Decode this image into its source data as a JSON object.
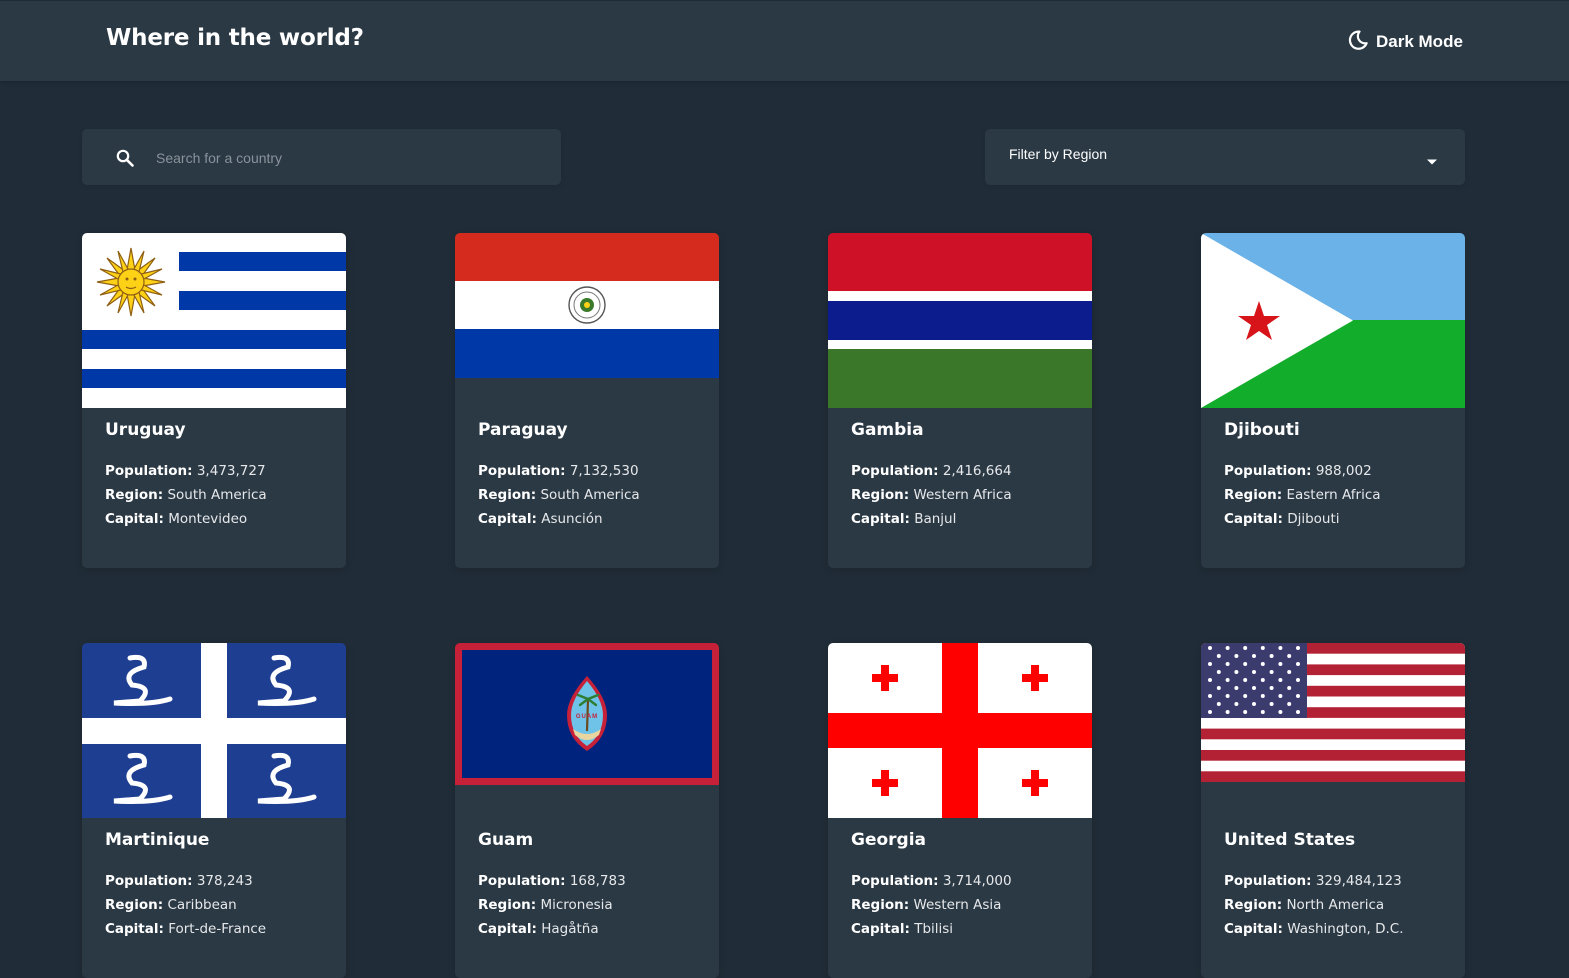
{
  "header": {
    "title": "Where in the world?",
    "mode_label": "Dark Mode"
  },
  "search": {
    "placeholder": "Search for a country",
    "value": ""
  },
  "filter": {
    "label": "Filter by Region"
  },
  "labels": {
    "population": "Population:",
    "region": "Region:",
    "capital": "Capital:"
  },
  "colors": {
    "background": "#202c37",
    "elements": "#2b3945",
    "text": "#ffffff"
  },
  "countries": [
    {
      "name": "Uruguay",
      "population": "3,473,727",
      "region": "South America",
      "capital": "Montevideo",
      "flag": "uruguay-flag"
    },
    {
      "name": "Paraguay",
      "population": "7,132,530",
      "region": "South America",
      "capital": "Asunción",
      "flag": "paraguay-flag"
    },
    {
      "name": "Gambia",
      "population": "2,416,664",
      "region": "Western Africa",
      "capital": "Banjul",
      "flag": "gambia-flag"
    },
    {
      "name": "Djibouti",
      "population": "988,002",
      "region": "Eastern Africa",
      "capital": "Djibouti",
      "flag": "djibouti-flag"
    },
    {
      "name": "Martinique",
      "population": "378,243",
      "region": "Caribbean",
      "capital": "Fort-de-France",
      "flag": "martinique-flag"
    },
    {
      "name": "Guam",
      "population": "168,783",
      "region": "Micronesia",
      "capital": "Hagåtña",
      "flag": "guam-flag"
    },
    {
      "name": "Georgia",
      "population": "3,714,000",
      "region": "Western Asia",
      "capital": "Tbilisi",
      "flag": "georgia-flag"
    },
    {
      "name": "United States",
      "population": "329,484,123",
      "region": "North America",
      "capital": "Washington, D.C.",
      "flag": "united-states-flag"
    }
  ]
}
